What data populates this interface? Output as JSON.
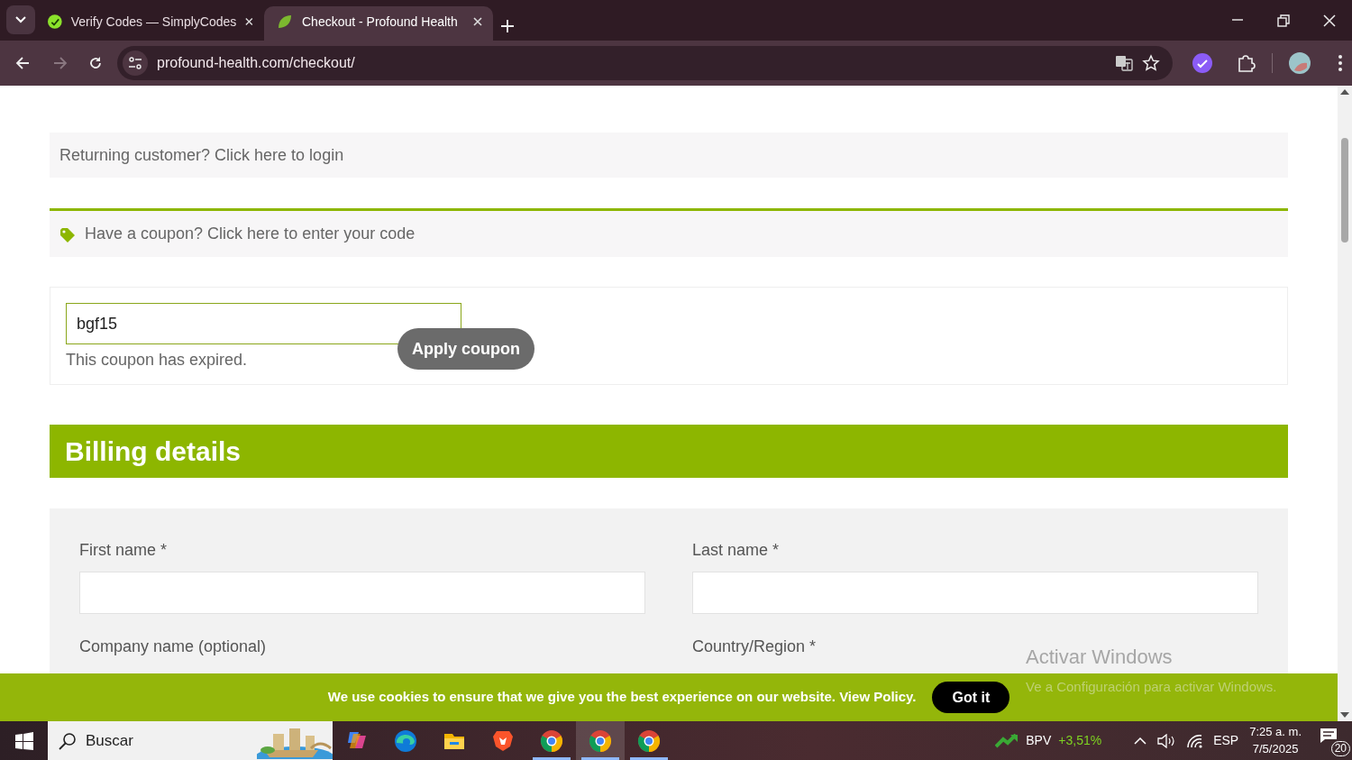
{
  "browser": {
    "tabs": [
      {
        "title": "Verify Codes — SimplyCodes",
        "selected": false,
        "kind": "simplycodes"
      },
      {
        "title": "Checkout - Profound Health",
        "selected": true,
        "kind": "leaf"
      }
    ],
    "url": "profound-health.com/checkout/"
  },
  "page": {
    "login_notice": "Returning customer? Click here to login",
    "coupon_notice": "Have a coupon? Click here to enter your code",
    "coupon_form": {
      "value": "bgf15",
      "error": "This coupon has expired.",
      "button": "Apply coupon"
    },
    "billing": {
      "title": "Billing details",
      "rows": [
        [
          {
            "label": "First name *",
            "kind": "input"
          },
          {
            "label": "Last name *",
            "kind": "input"
          }
        ],
        [
          {
            "label": "Company name (optional)",
            "kind": "label"
          },
          {
            "label": "Country/Region *",
            "kind": "label"
          }
        ]
      ]
    }
  },
  "cookie_bar": {
    "message": "We use cookies to ensure that we give you the best experience on our website.",
    "link": "View Policy",
    "message_end": ".",
    "button": "Got it"
  },
  "activation": {
    "title": "Activar Windows",
    "subtitle": "Ve a Configuración para activar Windows."
  },
  "taskbar": {
    "search_placeholder": "Buscar",
    "apps": [
      {
        "kind": "copilot",
        "running": false,
        "selected": false
      },
      {
        "kind": "edge",
        "running": false,
        "selected": false
      },
      {
        "kind": "explorer",
        "running": false,
        "selected": false
      },
      {
        "kind": "brave",
        "running": false,
        "selected": false
      },
      {
        "kind": "chrome",
        "running": true,
        "selected": false
      },
      {
        "kind": "chrome",
        "running": true,
        "selected": true
      },
      {
        "kind": "chrome",
        "running": true,
        "selected": false
      }
    ],
    "stock": {
      "symbol": "BPV",
      "change": "+3,51%"
    },
    "language": "ESP",
    "time": "7:25 a. m.",
    "date": "7/5/2025",
    "notifications": "20"
  }
}
